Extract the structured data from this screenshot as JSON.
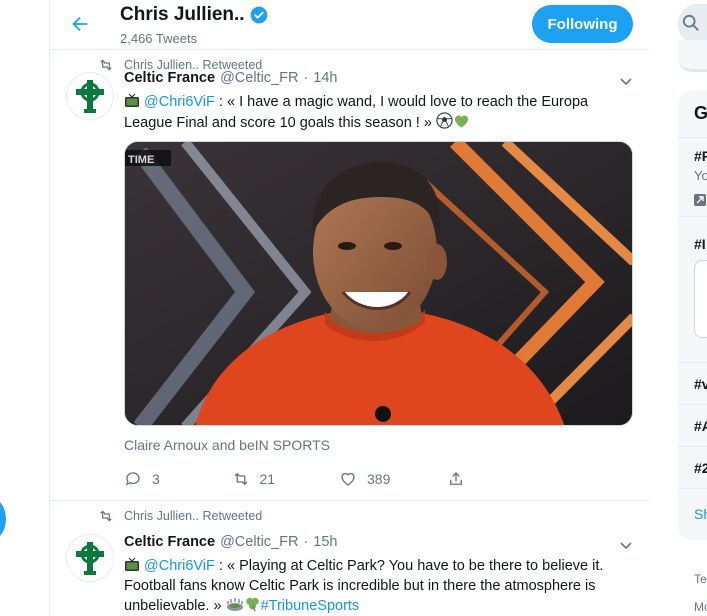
{
  "header": {
    "name": "Chris Jullien..",
    "tweet_count": "2,466 Tweets",
    "following_label": "Following"
  },
  "tweets": [
    {
      "retweeted_by": "Chris Jullien.. Retweeted",
      "author": "Celtic France",
      "handle": "@Celtic_FR",
      "dot": "·",
      "time": "14h",
      "mention": "@Chri6ViF",
      "text": " : « I have a magic wand, I would love to reach the Europa League Final and score 10 goals this season ! » ",
      "media_overlay": "TIME",
      "caption": "Claire Arnoux and beIN SPORTS",
      "replies": "3",
      "retweets": "21",
      "likes": "389"
    },
    {
      "retweeted_by": "Chris Jullien.. Retweeted",
      "author": "Celtic France",
      "handle": "@Celtic_FR",
      "dot": "·",
      "time": "15h",
      "mention": "@Chri6ViF",
      "text": " : « Playing at Celtic Park? You have to be there to believe it. Football fans know Celtic Park is incredible but in there the atmosphere is unbelievable. » ",
      "hashtag": "#TribuneSports"
    }
  ],
  "sidebar": {
    "trends_title_partial": "G",
    "trend1": "#F",
    "trend1_sub": "Yo",
    "trend2": "#I",
    "trend3": "#v",
    "trend4": "#A",
    "trend5": "#2",
    "show_more_partial": "Sh",
    "footer1": "Ter",
    "footer2": "Mc"
  },
  "colors": {
    "accent": "#1da1f2",
    "link": "#1b95e0",
    "celtic_green": "#0a7a3c",
    "shirt": "#e0461d"
  },
  "icons": [
    "back-arrow-icon",
    "verified-badge-icon",
    "retweet-icon",
    "chevron-down-icon",
    "tv-icon",
    "soccer-ball-icon",
    "green-heart-icon",
    "reply-icon",
    "like-icon",
    "share-icon",
    "search-icon",
    "stadium-icon",
    "shamrock-icon"
  ]
}
